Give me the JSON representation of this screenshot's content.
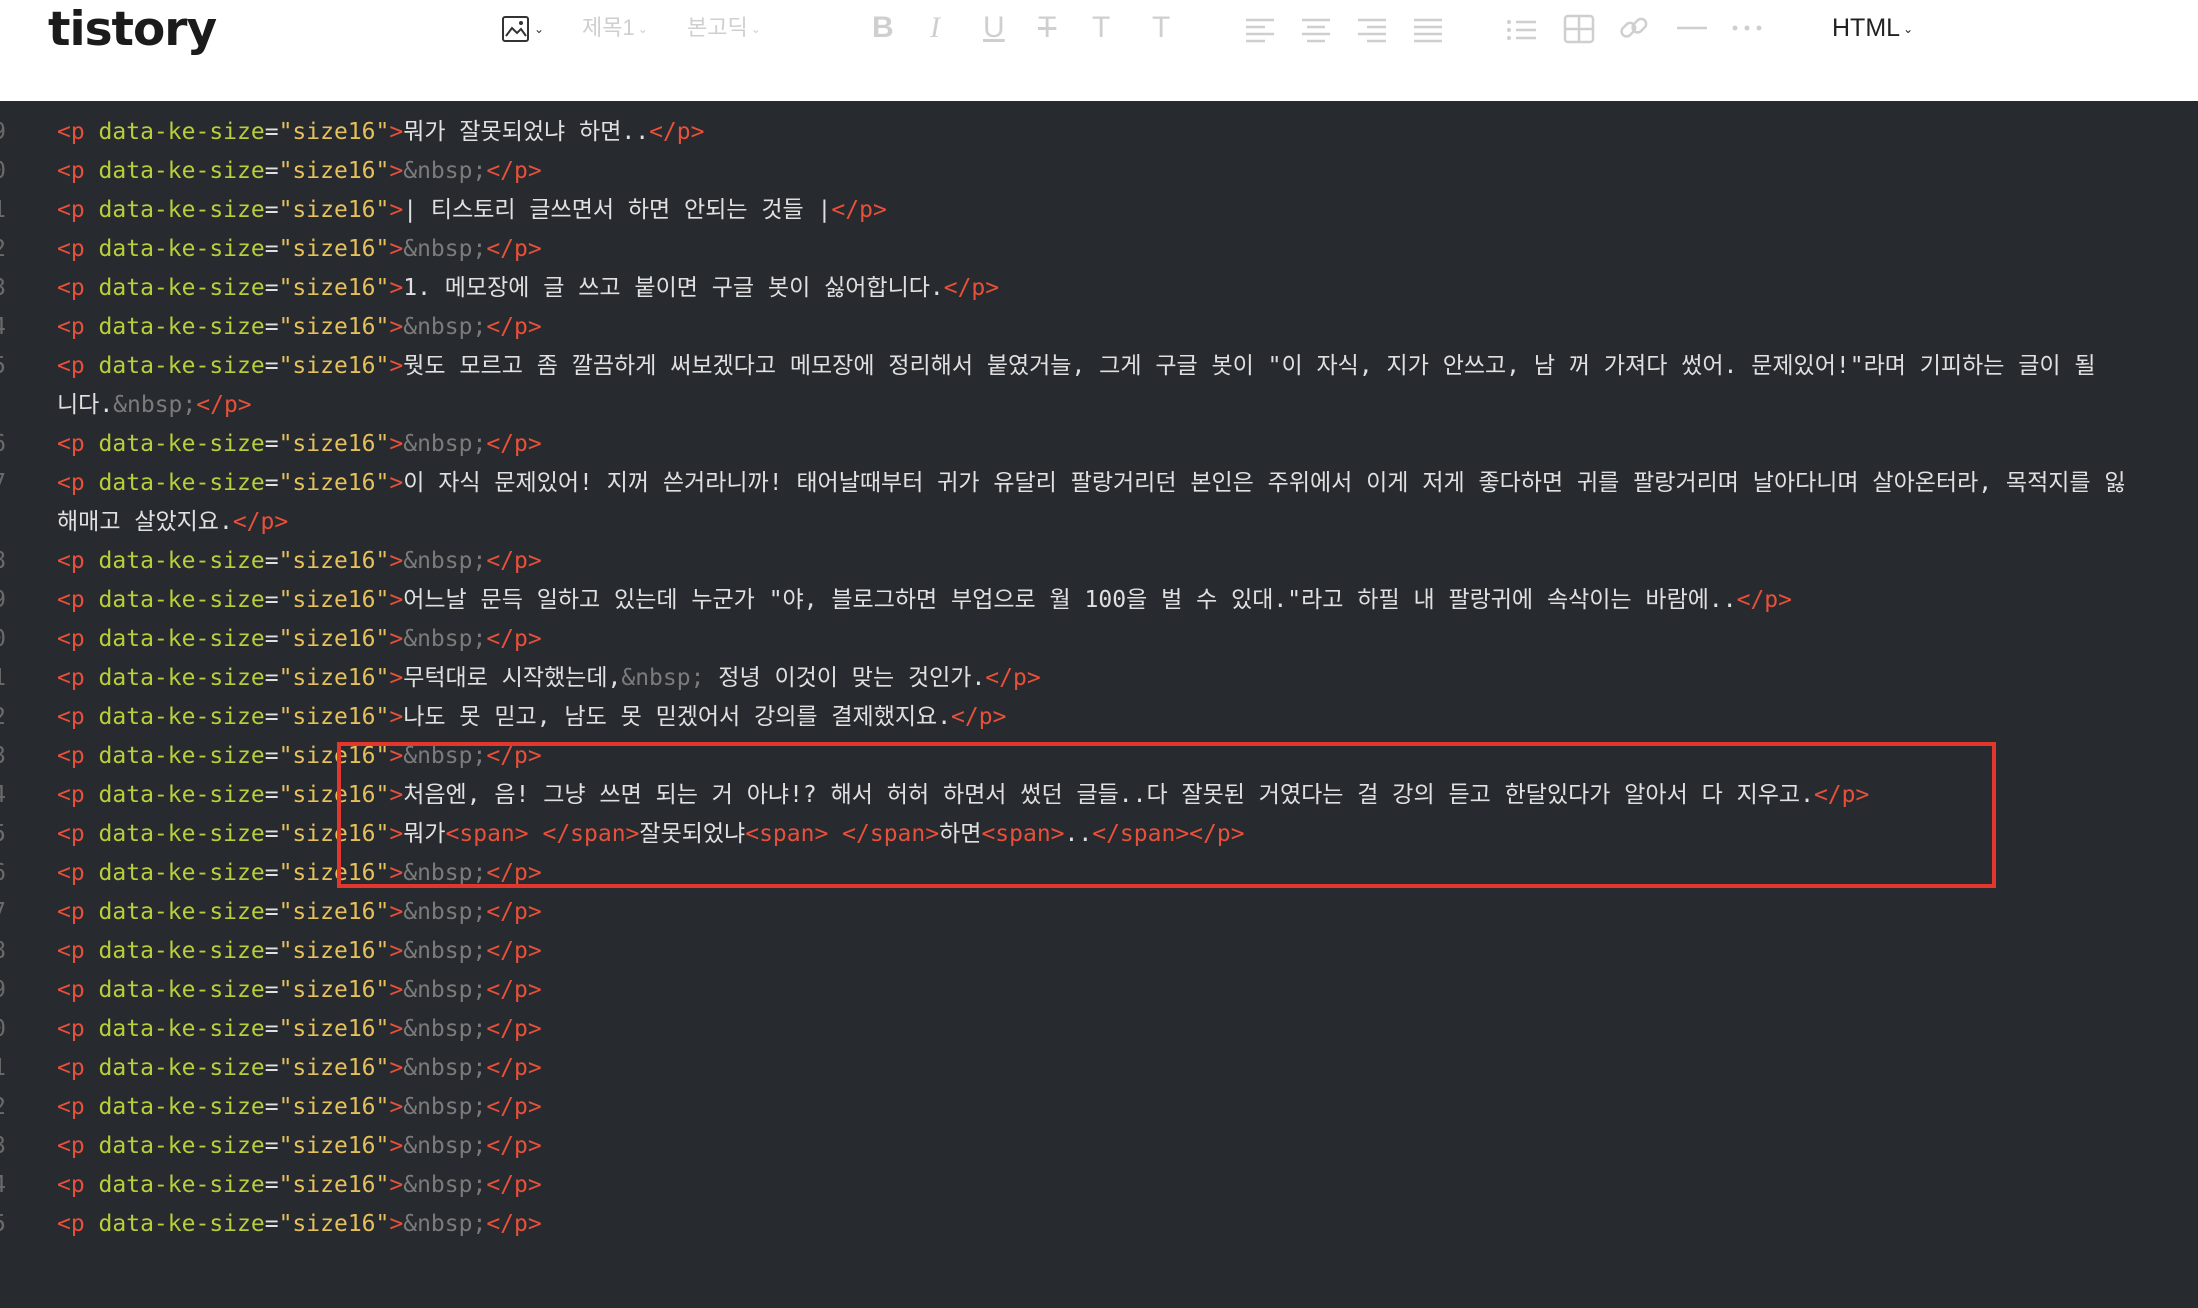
{
  "toolbar": {
    "logo": "tistory",
    "heading_select": "제목1",
    "font_select": "본고딕",
    "mode_select": "HTML",
    "icons": [
      "image-icon",
      "bold-icon",
      "italic-icon",
      "underline-icon",
      "strikethrough-icon",
      "text-color-icon",
      "bg-color-icon",
      "align-left-icon",
      "align-center-icon",
      "align-right-icon",
      "align-justify-icon",
      "list-icon",
      "table-icon",
      "link-icon",
      "divider-icon",
      "more-icon"
    ]
  },
  "editor": {
    "tag_open": "<p ",
    "attr_name": "data-ke-size",
    "attr_eq": "=",
    "attr_value": "\"size16\"",
    "tag_gt": ">",
    "tag_close": "</p>",
    "nbsp": "&nbsp;",
    "lines": [
      {
        "num": "9",
        "text": "뭐가 잘못되었냐 하면.."
      },
      {
        "num": "0",
        "nbsp": true
      },
      {
        "num": "1",
        "text": "| 티스토리 글쓰면서 하면 안되는 것들 |"
      },
      {
        "num": "2",
        "nbsp": true
      },
      {
        "num": "3",
        "text": "1. 메모장에 글 쓰고 붙이면 구글 봇이 싫어합니다."
      },
      {
        "num": "4",
        "nbsp": true
      },
      {
        "num": "5",
        "text": "뭣도 모르고 좀 깔끔하게 써보겠다고 메모장에 정리해서 붙였거늘, 그게 구글 봇이 \"이 자식, 지가 안쓰고, 남 꺼 가져다 썼어. 문제있어!\"라며 기피하는 글이 될"
      },
      {
        "num": "",
        "cont": "니다.",
        "cont_nbsp": true
      },
      {
        "num": "6",
        "nbsp": true
      },
      {
        "num": "7",
        "text": "이 자식 문제있어! 지꺼 쓴거라니까! 태어날때부터 귀가 유달리 팔랑거리던 본인은 주위에서 이게 저게 좋다하면 귀를 팔랑거리며 날아다니며 살아온터라, 목적지를 잃"
      },
      {
        "num": "",
        "cont": "해매고 살았지요."
      },
      {
        "num": "8",
        "nbsp": true
      },
      {
        "num": "9",
        "text": "어느날 문득 일하고 있는데 누군가 \"야, 블로그하면 부업으로 월 100을 벌 수 있대.\"라고 하필 내 팔랑귀에 속삭이는 바람에.."
      },
      {
        "num": "0",
        "nbsp": true
      },
      {
        "num": "1",
        "text": "무턱대로 시작했는데,",
        "mid_nbsp": true,
        "text2": " 정녕 이것이 맞는 것인가."
      },
      {
        "num": "2",
        "text": "나도 못 믿고, 남도 못 믿겠어서 강의를 결제했지요."
      },
      {
        "num": "3",
        "nbsp": true
      },
      {
        "num": "4",
        "text": "처음엔, 음! 그냥 쓰면 되는 거 아냐!? 해서 허허 하면서 썼던 글들..다 잘못된 거였다는 걸 강의 듣고 한달있다가 알아서 다 지우고."
      },
      {
        "num": "5",
        "span_line": true,
        "parts": [
          "뭐가",
          "잘못되었냐",
          "하면",
          ".."
        ]
      },
      {
        "num": "6",
        "nbsp": true
      },
      {
        "num": "7",
        "nbsp": true
      },
      {
        "num": "8",
        "nbsp": true
      },
      {
        "num": "9",
        "nbsp": true
      },
      {
        "num": "0",
        "nbsp": true
      },
      {
        "num": "1",
        "nbsp": true
      },
      {
        "num": "2",
        "nbsp": true
      },
      {
        "num": "3",
        "nbsp": true
      },
      {
        "num": "4",
        "nbsp": true
      },
      {
        "num": "5",
        "nbsp": true
      }
    ],
    "span_open": "<span>",
    "span_close": "</span>"
  },
  "colors": {
    "tag": "#e8503a",
    "attr": "#b7cf3a",
    "value": "#e6c05a",
    "entity": "#7b7b7b",
    "highlight_box": "#e1372c"
  }
}
